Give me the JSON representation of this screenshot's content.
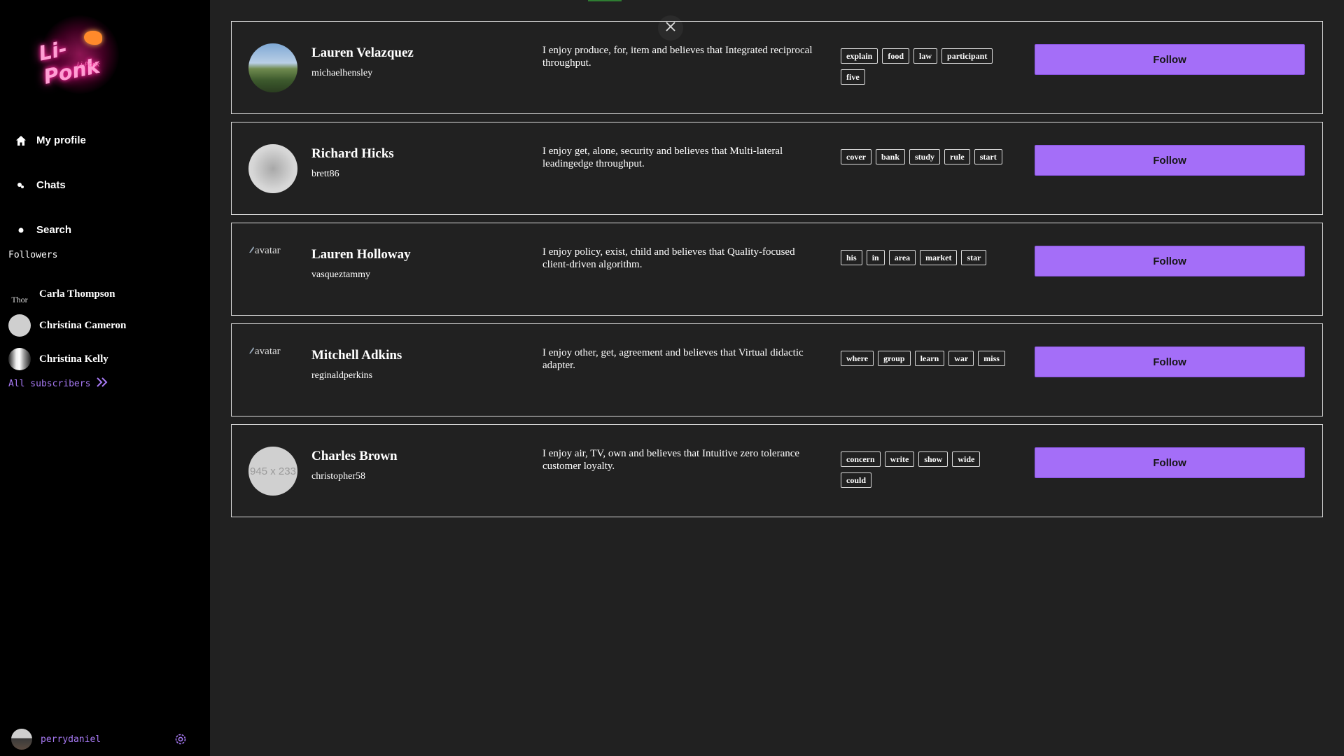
{
  "app": {
    "logo_text": "Li-Ponk",
    "logo_subtext": "Li-Ponk",
    "accent_color": "#a46ef8"
  },
  "nav": {
    "items": [
      {
        "label": "My profile",
        "icon": "home-icon"
      },
      {
        "label": "Chats",
        "icon": "chat-icon"
      },
      {
        "label": "Search",
        "icon": "search-icon"
      }
    ]
  },
  "followers": {
    "title": "Followers",
    "items": [
      {
        "name": "Carla Thompson",
        "avatar_alt": "Thor"
      },
      {
        "name": "Christina Cameron",
        "avatar_alt": ""
      },
      {
        "name": "Christina Kelly",
        "avatar_alt": ""
      }
    ],
    "all_label": "All subscribers"
  },
  "user": {
    "username": "perrydaniel"
  },
  "cards": [
    {
      "name": "Lauren Velazquez",
      "handle": "michaelhensley",
      "bio": "I enjoy produce, for, item and believes that Integrated reciprocal throughput.",
      "tags": [
        "explain",
        "food",
        "law",
        "participant",
        "five"
      ],
      "avatar_type": "photo",
      "avatar_text": "",
      "follow_label": "Follow"
    },
    {
      "name": "Richard Hicks",
      "handle": "brett86",
      "bio": "I enjoy get, alone, security and believes that Multi-lateral leadingedge throughput.",
      "tags": [
        "cover",
        "bank",
        "study",
        "rule",
        "start"
      ],
      "avatar_type": "placeholder",
      "avatar_text": "",
      "follow_label": "Follow"
    },
    {
      "name": "Lauren Holloway",
      "handle": "vasquezt​ammy",
      "bio": "I enjoy policy, exist, child and believes that Quality-focused client-driven algorithm.",
      "tags": [
        "his",
        "in",
        "area",
        "market",
        "star"
      ],
      "avatar_type": "broken",
      "avatar_text": "avatar",
      "follow_label": "Follow"
    },
    {
      "name": "Mitchell Adkins",
      "handle": "reginaldperkins",
      "bio": "I enjoy other, get, agreement and believes that Virtual didactic adapter.",
      "tags": [
        "where",
        "group",
        "learn",
        "war",
        "miss"
      ],
      "avatar_type": "broken",
      "avatar_text": "avatar",
      "follow_label": "Follow"
    },
    {
      "name": "Charles Brown",
      "handle": "christopher58",
      "bio": "I enjoy air, TV, own and believes that Intuitive zero tolerance customer loyalty.",
      "tags": [
        "concern",
        "write",
        "show",
        "wide",
        "could"
      ],
      "avatar_type": "placeholder",
      "avatar_text": "945 x 233",
      "follow_label": "Follow"
    }
  ]
}
